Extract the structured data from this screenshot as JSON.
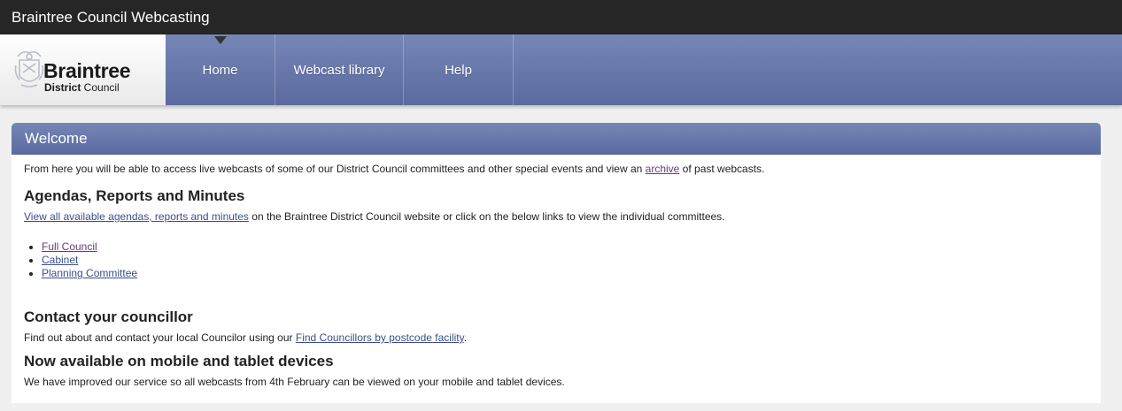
{
  "site_title": "Braintree Council Webcasting",
  "logo": {
    "main": "Braintree",
    "sub_bold": "District",
    "sub_rest": " Council"
  },
  "nav": {
    "items": [
      {
        "label": "Home",
        "active": true
      },
      {
        "label": "Webcast library"
      },
      {
        "label": "Help"
      }
    ]
  },
  "welcome": {
    "title": "Welcome",
    "intro_before": "From here you will be able to access live webcasts of some of our District Council committees and other special events and view an ",
    "intro_link": "archive",
    "intro_after": " of past webcasts."
  },
  "agendas": {
    "heading": "Agendas, Reports and Minutes",
    "link": "View all available agendas, reports and minutes",
    "text_after": " on the Braintree District Council website or click on the below links to view the individual committees.",
    "committees": [
      "Full Council",
      "Cabinet",
      "Planning Committee"
    ]
  },
  "contact": {
    "heading": "Contact your councillor",
    "text_before": "Find out about and contact your local Councilor using our ",
    "link": "Find Councillors by postcode facility",
    "text_after": "."
  },
  "mobile": {
    "heading": "Now available on mobile and tablet devices",
    "text": "We have improved our service so all webcasts from 4th February can be viewed on your mobile and tablet devices."
  },
  "colors": {
    "topbar": "#262626",
    "nav_gradient_top": "#7686b6",
    "nav_gradient_bottom": "#5b6a9f",
    "link": "#3c4f8a",
    "visited_link": "#6b3a7a"
  }
}
